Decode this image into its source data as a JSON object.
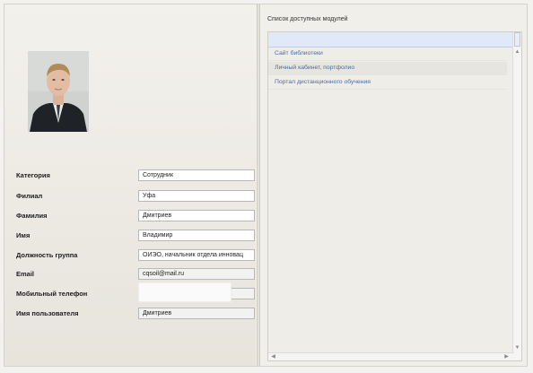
{
  "profile": {
    "photo_icon": "person-photo",
    "fields": [
      {
        "label": "Категория",
        "value": "Сотрудник"
      },
      {
        "label": "Филиал",
        "value": "Уфа"
      },
      {
        "label": "Фамилия",
        "value": "Дмитриев"
      },
      {
        "label": "Имя",
        "value": "Владимир"
      },
      {
        "label": "Должность группа",
        "value": "ОИЭО, начальник отдела инновац"
      },
      {
        "label": "Email",
        "value": "cqsoil@mail.ru"
      },
      {
        "label": "Мобильный телефон",
        "value": ""
      },
      {
        "label": "Имя пользователя",
        "value": "Дмитриев"
      }
    ]
  },
  "modules": {
    "title": "Список доступных модулей",
    "items": [
      "Сайт библиотеки",
      "Личный кабинет, портфолио",
      "Портал дистанционного обучения"
    ]
  },
  "colors": {
    "link": "#4a6d9c",
    "selection": "#dfe9f7"
  }
}
